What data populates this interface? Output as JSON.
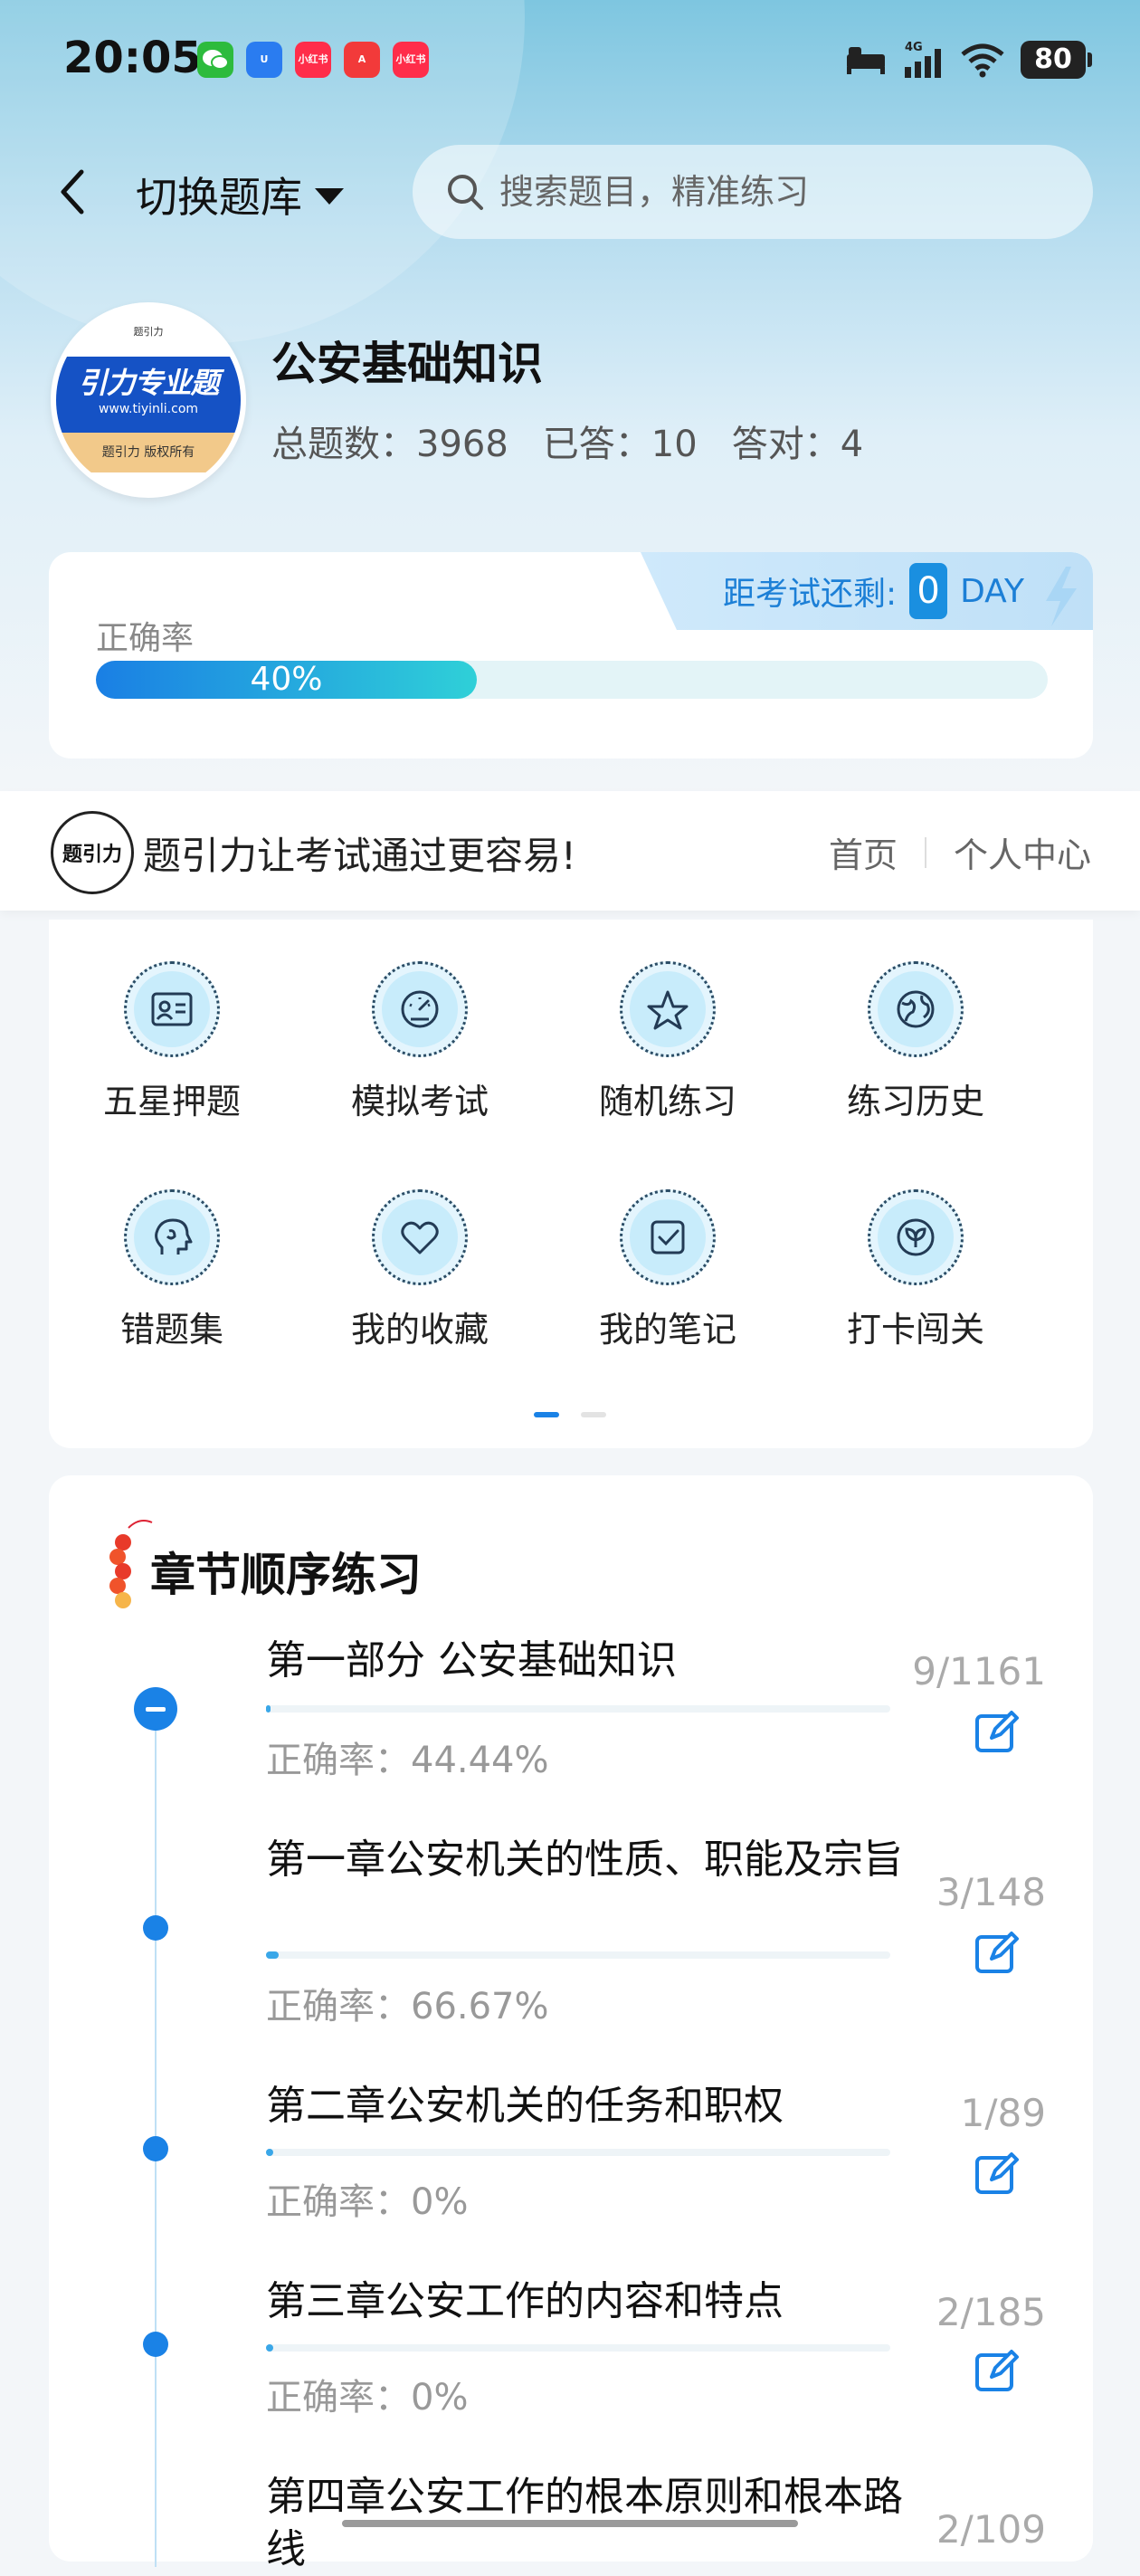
{
  "status_bar": {
    "time": "20:05",
    "notif_apps": [
      "wechat",
      "u-app",
      "小红书",
      "a-app",
      "小红书"
    ],
    "network": "4G",
    "battery": "80"
  },
  "header": {
    "switch_label": "切换题库",
    "search_placeholder": "搜索题目，精准练习"
  },
  "bank": {
    "logo_brand": "引力专业题",
    "logo_url": "www.tiyinli.com",
    "logo_foot": "题引力 版权所有",
    "logo_top": "题引力",
    "title": "公安基础知识",
    "total": "总题数：3968",
    "answered": "已答：10",
    "correct": "答对：4"
  },
  "accuracy": {
    "label": "正确率",
    "percent_text": "40%",
    "percent": 40,
    "countdown_label": "距考试还剩:",
    "days": "0",
    "unit": "DAY"
  },
  "banner": {
    "logo_text": "题引力",
    "slogan": "题引力让考试通过更容易!",
    "nav_home": "首页",
    "nav_profile": "个人中心"
  },
  "menu": [
    {
      "label": "五星押题",
      "icon": "id-card-icon"
    },
    {
      "label": "模拟考试",
      "icon": "speedometer-icon"
    },
    {
      "label": "随机练习",
      "icon": "star-network-icon"
    },
    {
      "label": "练习历史",
      "icon": "globe-icon"
    },
    {
      "label": "错题集",
      "icon": "head-icon"
    },
    {
      "label": "我的收藏",
      "icon": "heart-icon"
    },
    {
      "label": "我的笔记",
      "icon": "checkbox-icon"
    },
    {
      "label": "打卡闯关",
      "icon": "leaf-badge-icon"
    }
  ],
  "chapters": {
    "title": "章节顺序练习",
    "items": [
      {
        "name": "第一部分 公安基础知识",
        "acc": "正确率：44.44%",
        "count": "9/1161",
        "progress": 0.0078
      },
      {
        "name": "第一章公安机关的性质、职能及宗旨",
        "acc": "正确率：66.67%",
        "count": "3/148",
        "progress": 0.02
      },
      {
        "name": "第二章公安机关的任务和职权",
        "acc": "正确率：0%",
        "count": "1/89",
        "progress": 0.011
      },
      {
        "name": "第三章公安工作的内容和特点",
        "acc": "正确率：0%",
        "count": "2/185",
        "progress": 0.011
      },
      {
        "name": "第四章公安工作的根本原则和根本路线",
        "acc": "",
        "count": "2/109",
        "progress": 0.018
      }
    ]
  },
  "colors": {
    "accent": "#1a82e6",
    "teal": "#2fd0d8"
  }
}
